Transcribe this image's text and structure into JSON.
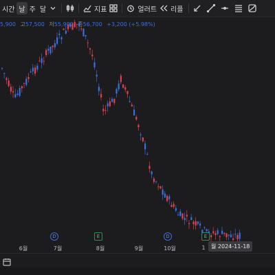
{
  "toolbar": {
    "time_label": "시간",
    "day_label": "날",
    "week_label": "주",
    "month_label": "달",
    "indicator_label": "지표",
    "alert_label": "얼러트",
    "replay_label": "리플"
  },
  "legend": {
    "open": "5,900",
    "high_label": "고",
    "high": "57,500",
    "low_label": "저",
    "low": "55,900",
    "close_label": "종",
    "close": "56,700",
    "change": "+3,200 (+5.98%)"
  },
  "x_axis": {
    "labels": [
      "6월",
      "7월",
      "8월",
      "9월",
      "10월",
      "1"
    ],
    "crosshair_date": "월 2024-11-18"
  },
  "events": [
    {
      "type": "D",
      "label": "D"
    },
    {
      "type": "E",
      "label": "E"
    },
    {
      "type": "D",
      "label": "D"
    },
    {
      "type": "E",
      "label": "E"
    }
  ],
  "colors": {
    "up": "#e0424e",
    "down": "#3b6fe0",
    "background": "#1c1c1f"
  }
}
